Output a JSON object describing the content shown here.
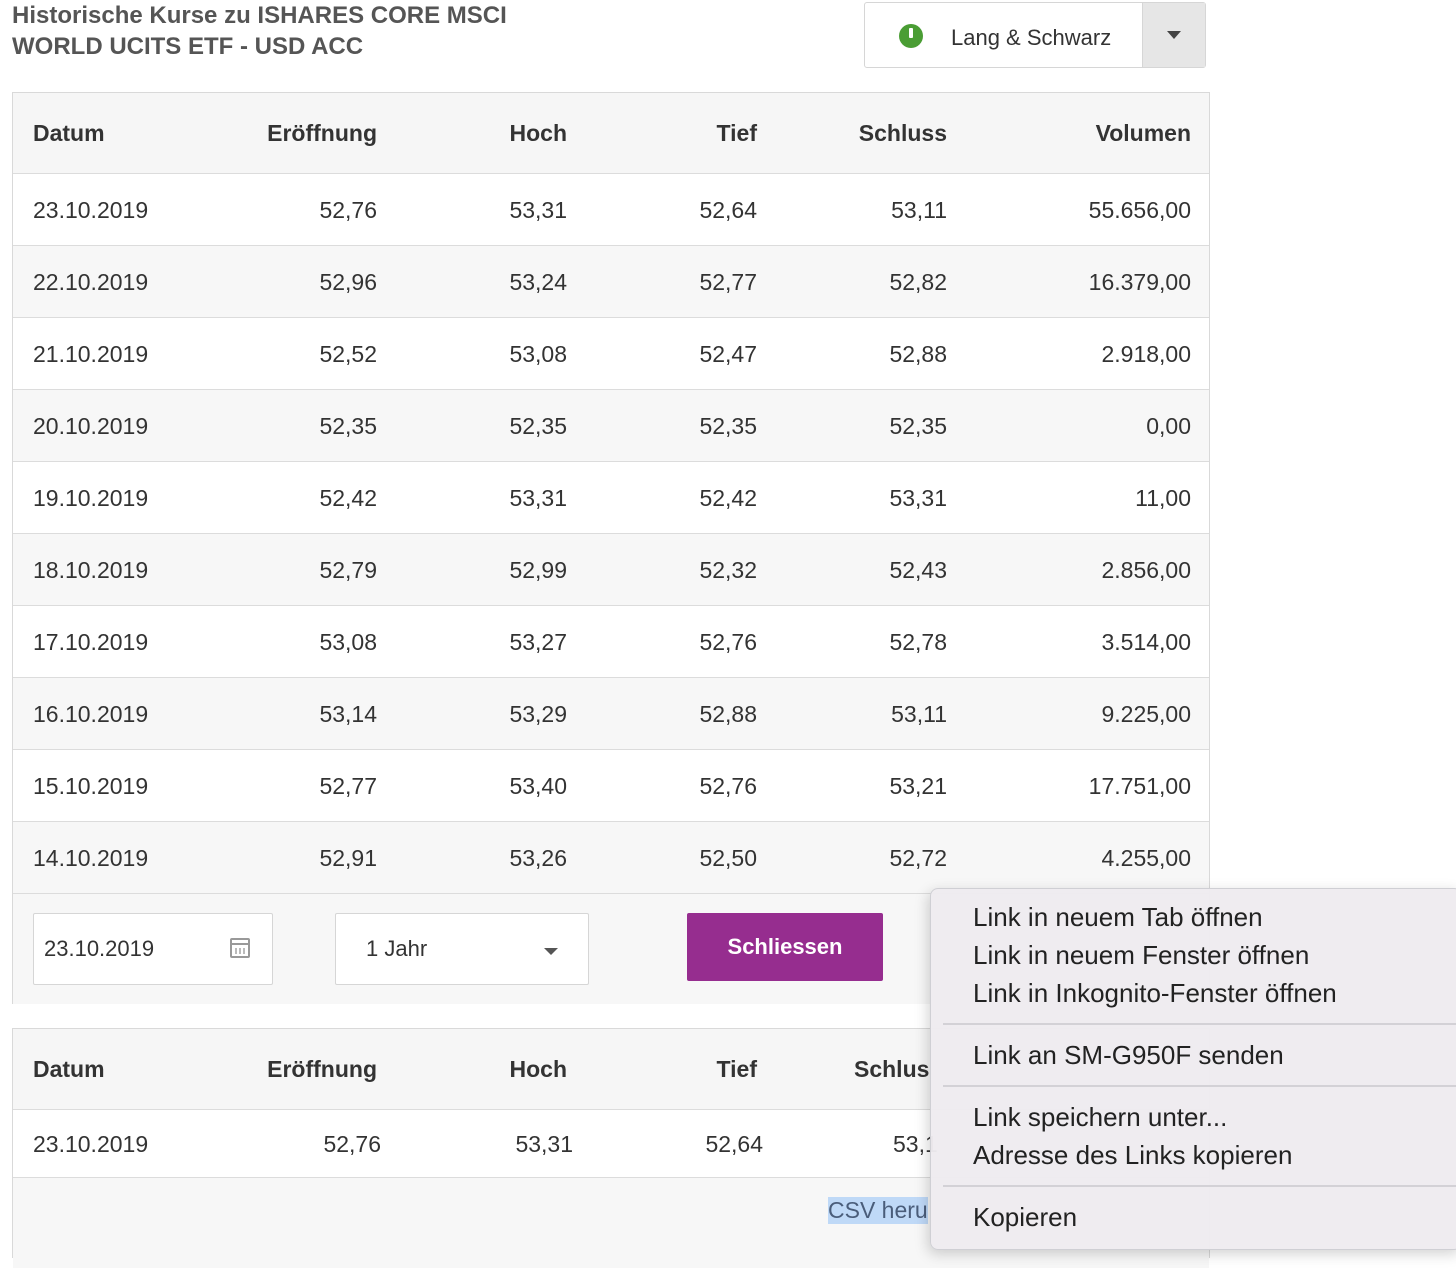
{
  "title_line1": "Historische Kurse zu ISHARES CORE MSCI",
  "title_line2": "WORLD UCITS ETF - USD ACC",
  "exchange": {
    "name": "Lang & Schwarz",
    "status_color": "#4a9d34"
  },
  "columns": [
    "Datum",
    "Eröffnung",
    "Hoch",
    "Tief",
    "Schluss",
    "Volumen"
  ],
  "rows": [
    [
      "23.10.2019",
      "52,76",
      "53,31",
      "52,64",
      "53,11",
      "55.656,00"
    ],
    [
      "22.10.2019",
      "52,96",
      "53,24",
      "52,77",
      "52,82",
      "16.379,00"
    ],
    [
      "21.10.2019",
      "52,52",
      "53,08",
      "52,47",
      "52,88",
      "2.918,00"
    ],
    [
      "20.10.2019",
      "52,35",
      "52,35",
      "52,35",
      "52,35",
      "0,00"
    ],
    [
      "19.10.2019",
      "52,42",
      "53,31",
      "52,42",
      "53,31",
      "11,00"
    ],
    [
      "18.10.2019",
      "52,79",
      "52,99",
      "52,32",
      "52,43",
      "2.856,00"
    ],
    [
      "17.10.2019",
      "53,08",
      "53,27",
      "52,76",
      "52,78",
      "3.514,00"
    ],
    [
      "16.10.2019",
      "53,14",
      "53,29",
      "52,88",
      "53,11",
      "9.225,00"
    ],
    [
      "15.10.2019",
      "52,77",
      "53,40",
      "52,76",
      "53,21",
      "17.751,00"
    ],
    [
      "14.10.2019",
      "52,91",
      "53,26",
      "52,50",
      "52,72",
      "4.255,00"
    ]
  ],
  "controls": {
    "date_value": "23.10.2019",
    "period_value": "1 Jahr",
    "close_label": "Schliessen"
  },
  "second_table": {
    "columns": [
      "Datum",
      "Eröffnung",
      "Hoch",
      "Tief",
      "Schlus"
    ],
    "row": [
      "23.10.2019",
      "52,76",
      "53,31",
      "52,64",
      "53,1"
    ],
    "csv_link": "CSV heru"
  },
  "context_menu": {
    "items": [
      "Link in neuem Tab öffnen",
      "Link in neuem Fenster öffnen",
      "Link in Inkognito-Fenster öffnen",
      "Link an SM-G950F senden",
      "Link speichern unter...",
      "Adresse des Links kopieren",
      "Kopieren"
    ]
  }
}
